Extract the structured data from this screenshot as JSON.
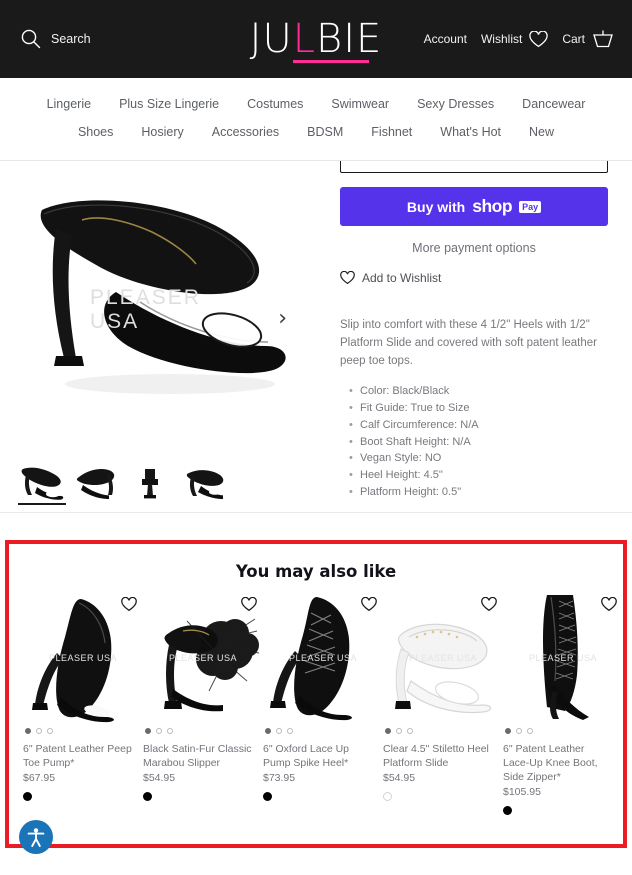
{
  "brand": {
    "logo_prefix": "JU",
    "logo_accent": "L",
    "logo_suffix": "BIE",
    "accent_color": "#ff2d95"
  },
  "header": {
    "search_label": "Search",
    "search_icon": "search-icon",
    "account_label": "Account",
    "wishlist_label": "Wishlist",
    "wishlist_icon": "heart-icon",
    "cart_label": "Cart",
    "cart_icon": "cart-basket-icon",
    "background": "#1a1a1a"
  },
  "nav": {
    "row1": [
      {
        "label": "Lingerie"
      },
      {
        "label": "Plus Size Lingerie"
      },
      {
        "label": "Costumes"
      },
      {
        "label": "Swimwear"
      },
      {
        "label": "Sexy Dresses"
      },
      {
        "label": "Dancewear"
      }
    ],
    "row2": [
      {
        "label": "Shoes"
      },
      {
        "label": "Hosiery"
      },
      {
        "label": "Accessories"
      },
      {
        "label": "BDSM"
      },
      {
        "label": "Fishnet"
      },
      {
        "label": "What's Hot"
      },
      {
        "label": "New"
      }
    ]
  },
  "gallery": {
    "watermark": "PLEASER USA",
    "next_arrow": "›",
    "thumbnail_count": 4,
    "active_thumbnail": 0
  },
  "purchase": {
    "shoppay_prefix": "Buy with",
    "shoppay_brand": "shop",
    "shoppay_badge": "Pay",
    "shoppay_color": "#5433eb",
    "more_payment_options": "More payment options",
    "add_to_wishlist": "Add to Wishlist"
  },
  "description": {
    "paragraph": "Slip into comfort with these 4 1/2\" Heels with 1/2\" Platform Slide and covered with soft patent leather peep toe tops.",
    "specs": [
      "Color: Black/Black",
      "Fit Guide: True to Size",
      "Calf Circumference: N/A",
      "Boot Shaft Height: N/A",
      "Vegan Style: NO",
      "Heel Height: 4.5\"",
      "Platform Height: 0.5\""
    ]
  },
  "recommendations": {
    "title": "You may also like",
    "highlight_color": "#ec1c24",
    "watermark": "PLEASER USA",
    "products": [
      {
        "name": "6\" Patent Leather Peep Toe Pump*",
        "price": "$67.95",
        "swatch": "black",
        "dots": 3,
        "active_dot": 0,
        "heart_icon": "heart-icon"
      },
      {
        "name": "Black Satin-Fur Classic Marabou Slipper",
        "price": "$54.95",
        "swatch": "black",
        "dots": 3,
        "active_dot": 0,
        "heart_icon": "heart-icon"
      },
      {
        "name": "6\" Oxford Lace Up Pump Spike Heel*",
        "price": "$73.95",
        "swatch": "black",
        "dots": 3,
        "active_dot": 0,
        "heart_icon": "heart-icon"
      },
      {
        "name": "Clear 4.5\" Stiletto Heel Platform Slide",
        "price": "$54.95",
        "swatch": "clear",
        "dots": 3,
        "active_dot": 0,
        "heart_icon": "heart-icon"
      },
      {
        "name": "6\" Patent Leather Lace-Up Knee Boot, Side Zipper*",
        "price": "$105.95",
        "swatch": "black",
        "dots": 3,
        "active_dot": 0,
        "heart_icon": "heart-icon"
      }
    ]
  },
  "accessibility_widget": {
    "icon": "accessibility-person-icon",
    "color": "#1b74b8"
  }
}
